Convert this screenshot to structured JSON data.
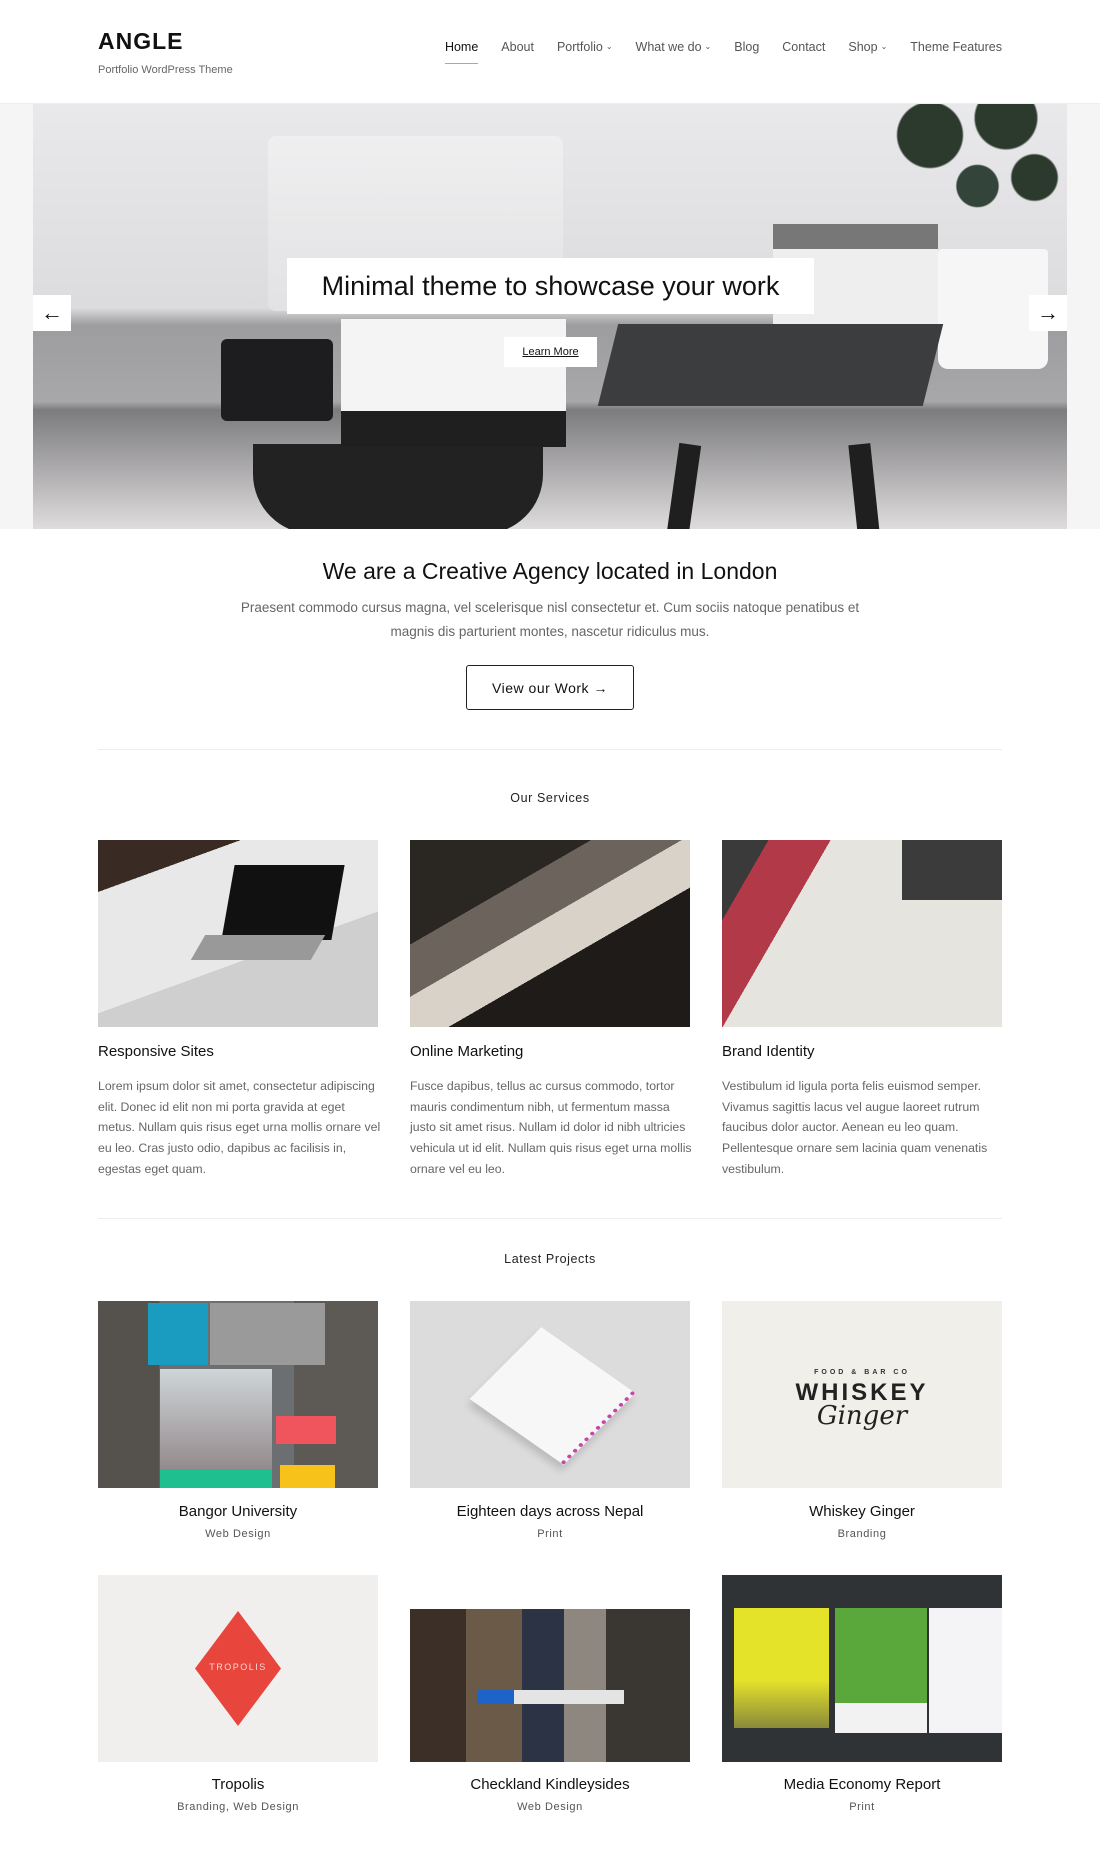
{
  "header": {
    "logo": "ANGLE",
    "tagline": "Portfolio WordPress Theme",
    "nav": [
      {
        "label": "Home",
        "active": true
      },
      {
        "label": "About"
      },
      {
        "label": "Portfolio",
        "dropdown": true
      },
      {
        "label": "What we do",
        "dropdown": true
      },
      {
        "label": "Blog"
      },
      {
        "label": "Contact"
      },
      {
        "label": "Shop",
        "dropdown": true
      },
      {
        "label": "Theme Features"
      }
    ]
  },
  "hero": {
    "title": "Minimal theme to showcase your work",
    "button": "Learn More",
    "prev_icon": "arrow-left-icon",
    "next_icon": "arrow-right-icon",
    "prev_glyph": "←",
    "next_glyph": "→"
  },
  "intro": {
    "heading": "We are a Creative Agency located in London",
    "text": "Praesent commodo cursus magna, vel scelerisque nisl consectetur et. Cum sociis natoque penatibus et magnis dis parturient montes, nascetur ridiculus mus.",
    "button": "View our Work →"
  },
  "services": {
    "title": "Our Services",
    "items": [
      {
        "title": "Responsive Sites",
        "text": "Lorem ipsum dolor sit amet, consectetur adipiscing elit. Donec id elit non mi porta gravida at eget metus. Nullam quis risus eget urna mollis ornare vel eu leo. Cras justo odio, dapibus ac facilisis in, egestas eget quam."
      },
      {
        "title": "Online Marketing",
        "text": "Fusce dapibus, tellus ac cursus commodo, tortor mauris condimentum nibh, ut fermentum massa justo sit amet risus. Nullam id dolor id nibh ultricies vehicula ut id elit. Nullam quis risus eget urna mollis ornare vel eu leo."
      },
      {
        "title": "Brand Identity",
        "text": "Vestibulum id ligula porta felis euismod semper. Vivamus sagittis lacus vel augue laoreet rutrum faucibus dolor auctor. Aenean eu leo quam. Pellentesque ornare sem lacinia quam venenatis vestibulum."
      }
    ]
  },
  "projects": {
    "title": "Latest Projects",
    "items": [
      {
        "title": "Bangor University",
        "category": "Web Design"
      },
      {
        "title": "Eighteen days across Nepal",
        "category": "Print"
      },
      {
        "title": "Whiskey Ginger",
        "category": "Branding",
        "logo_top": "FOOD & BAR CO",
        "logo_main": "WHISKEY",
        "logo_script": "Ginger"
      },
      {
        "title": "Tropolis",
        "category": "Branding, Web Design",
        "logo": "TROPOLIS"
      },
      {
        "title": "Checkland Kindleysides",
        "category": "Web Design"
      },
      {
        "title": "Media Economy Report",
        "category": "Print"
      }
    ]
  },
  "colors": {
    "accent": "#c9a27e",
    "text": "#222222",
    "muted": "#666666",
    "tropolis_red": "#e8453c"
  }
}
